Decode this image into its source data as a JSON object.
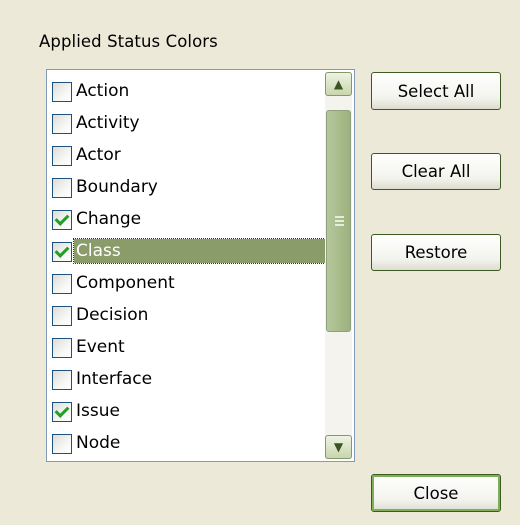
{
  "group_label": "Applied Status Colors",
  "list": {
    "items": [
      {
        "label": "Action",
        "checked": false,
        "selected": false
      },
      {
        "label": "Activity",
        "checked": false,
        "selected": false
      },
      {
        "label": "Actor",
        "checked": false,
        "selected": false
      },
      {
        "label": "Boundary",
        "checked": false,
        "selected": false
      },
      {
        "label": "Change",
        "checked": true,
        "selected": false
      },
      {
        "label": "Class",
        "checked": true,
        "selected": true
      },
      {
        "label": "Component",
        "checked": false,
        "selected": false
      },
      {
        "label": "Decision",
        "checked": false,
        "selected": false
      },
      {
        "label": "Event",
        "checked": false,
        "selected": false
      },
      {
        "label": "Interface",
        "checked": false,
        "selected": false
      },
      {
        "label": "Issue",
        "checked": true,
        "selected": false
      },
      {
        "label": "Node",
        "checked": false,
        "selected": false
      }
    ],
    "scroll_up_icon": "scroll-up-arrow-icon",
    "scroll_down_icon": "scroll-down-arrow-icon"
  },
  "buttons": {
    "select_all": "Select All",
    "clear_all": "Clear All",
    "restore": "Restore",
    "close": "Close"
  },
  "colors": {
    "dialog_bg": "#ece9d8",
    "selection_bg": "#8a9c6a",
    "check_mark": "#21a121"
  }
}
